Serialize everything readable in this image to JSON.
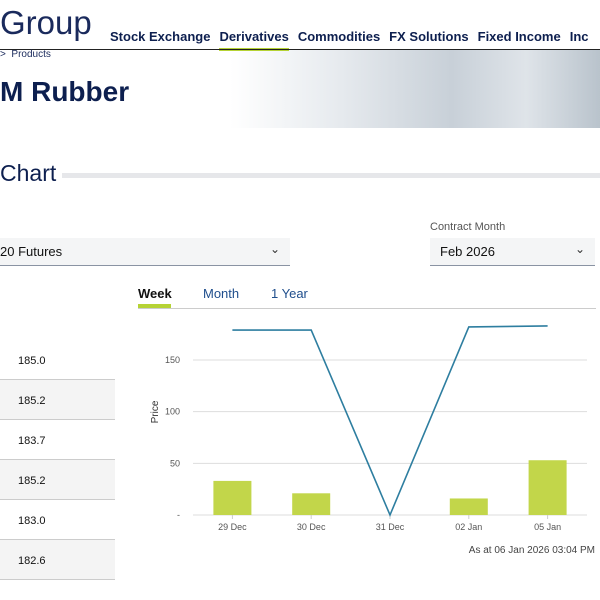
{
  "header": {
    "logo": "Group",
    "nav": [
      {
        "label": "Stock Exchange"
      },
      {
        "label": "Derivatives",
        "active": true
      },
      {
        "label": "Commodities"
      },
      {
        "label": "FX Solutions"
      },
      {
        "label": "Fixed Income"
      },
      {
        "label": "Inc"
      }
    ]
  },
  "breadcrumb": {
    "sep": ">",
    "item": "Products"
  },
  "page_title": "M Rubber",
  "section_title": "Chart",
  "product_select": {
    "value": "20 Futures"
  },
  "contract_month": {
    "label": "Contract Month",
    "value": "Feb 2026"
  },
  "left_table": {
    "values": [
      "185.0",
      "185.2",
      "183.7",
      "185.2",
      "183.0",
      "182.6"
    ]
  },
  "tabs": [
    {
      "label": "Week",
      "active": true
    },
    {
      "label": "Month"
    },
    {
      "label": "1 Year"
    }
  ],
  "as_at": "As at 06 Jan 2026 03:04 PM",
  "chart_data": {
    "type": "bar+line",
    "ylabel": "Price",
    "ylim": [
      0,
      190
    ],
    "yticks": [
      {
        "v": 0,
        "label": "-"
      },
      {
        "v": 50,
        "label": "50"
      },
      {
        "v": 100,
        "label": "100"
      },
      {
        "v": 150,
        "label": "150"
      }
    ],
    "categories": [
      "29 Dec",
      "30 Dec",
      "31 Dec",
      "02 Jan",
      "05 Jan"
    ],
    "line": {
      "values": [
        179,
        179,
        0,
        182,
        183
      ],
      "color": "#2e7ea0"
    },
    "bars": {
      "values": [
        33,
        21,
        0,
        16,
        53
      ],
      "color": "#c2d64a"
    },
    "grid": true
  }
}
